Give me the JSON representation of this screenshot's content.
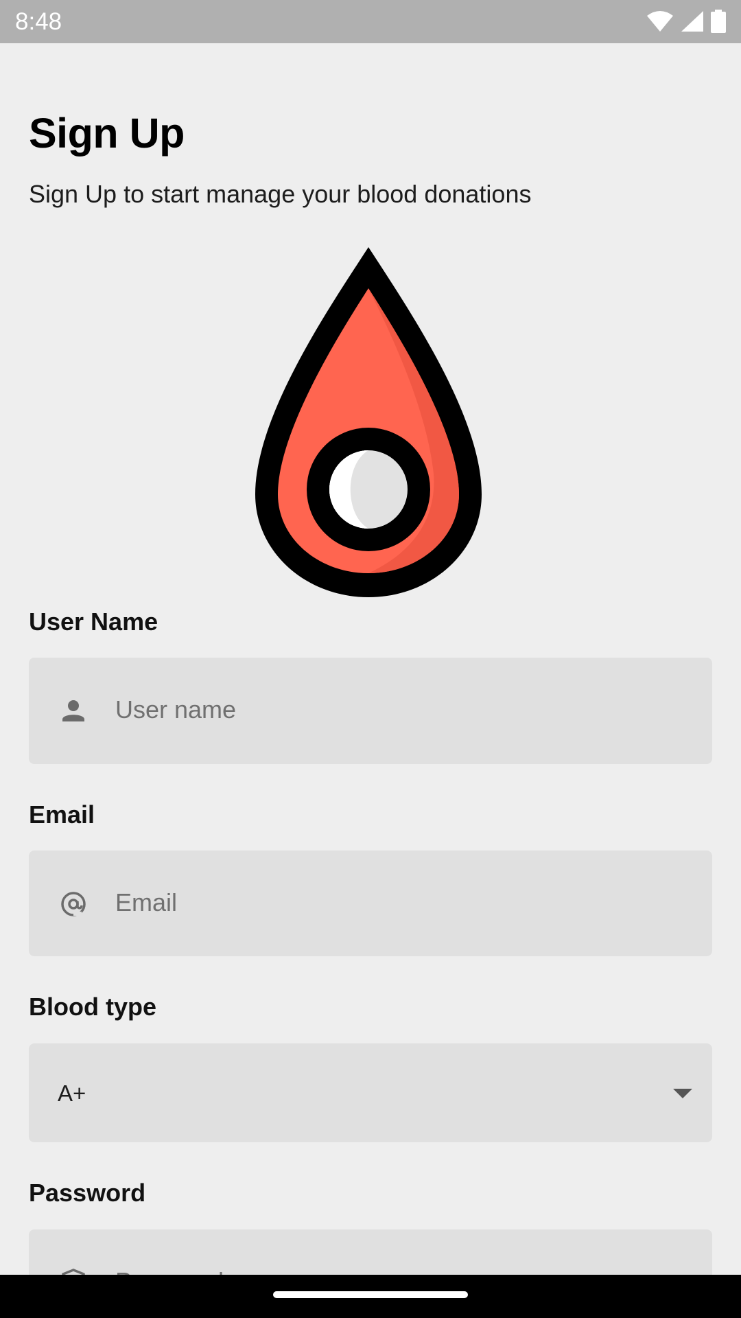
{
  "status_bar": {
    "time": "8:48",
    "icons": [
      "wifi-icon",
      "signal-icon",
      "battery-icon"
    ]
  },
  "header": {
    "title": "Sign Up",
    "subtitle": "Sign Up to start manage your blood donations"
  },
  "logo": {
    "icon": "blood-drop-icon",
    "colors": {
      "fill": "#ff6550",
      "shade": "#f05743",
      "outline": "#000000",
      "center": "#ffffff"
    }
  },
  "form": {
    "username": {
      "label": "User Name",
      "placeholder": "User name",
      "icon": "person-icon"
    },
    "email": {
      "label": "Email",
      "placeholder": "Email",
      "icon": "at-icon"
    },
    "blood_type": {
      "label": "Blood type",
      "value": "A+",
      "icon": "dropdown-arrow-icon"
    },
    "password": {
      "label": "Password",
      "placeholder": "Password",
      "icon": "lock-icon"
    }
  },
  "colors": {
    "background": "#eeeeee",
    "field": "#e0e0e0",
    "status_bar": "#b0b0b0"
  }
}
